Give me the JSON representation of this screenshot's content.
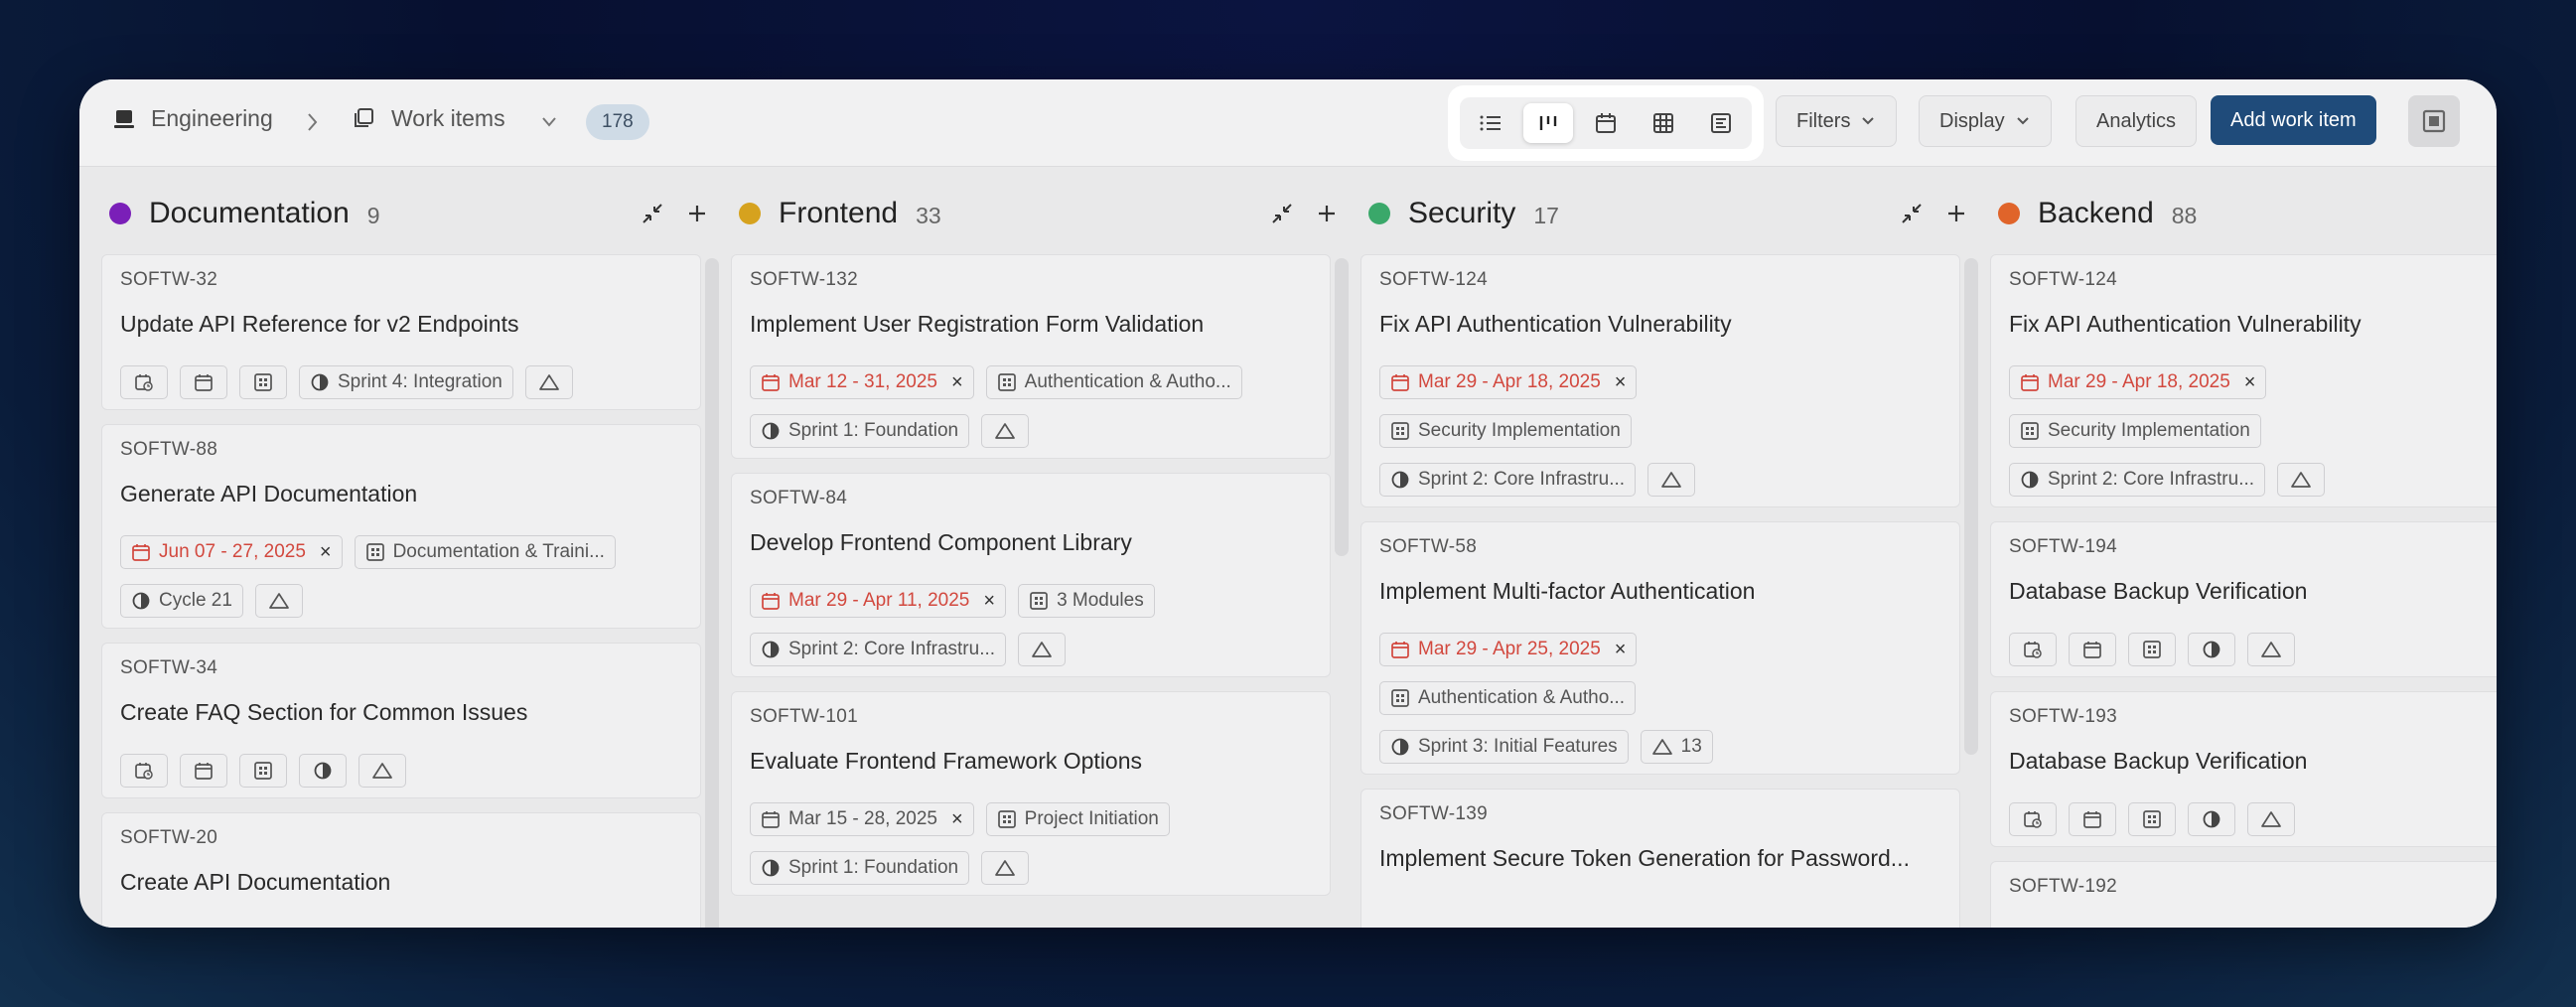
{
  "header": {
    "workspace": "Engineering",
    "section": "Work items",
    "count": "178",
    "filters_label": "Filters",
    "display_label": "Display",
    "analytics_label": "Analytics",
    "add_label": "Add work item"
  },
  "columns": [
    {
      "title": "Documentation",
      "count": "9",
      "color": "#7a1fb8",
      "cards": [
        {
          "id": "SOFTW-32",
          "title": "Update API Reference for v2 Endpoints",
          "rows": [
            [
              {
                "icon": "clock"
              },
              {
                "icon": "calendar"
              },
              {
                "icon": "module"
              },
              {
                "icon": "cycle",
                "text": "Sprint 4: Integration"
              },
              {
                "icon": "estimate"
              }
            ]
          ]
        },
        {
          "id": "SOFTW-88",
          "title": "Generate API Documentation",
          "rows": [
            [
              {
                "icon": "calendar",
                "text": "Jun 07 - 27, 2025",
                "red": true,
                "x": true
              },
              {
                "icon": "module",
                "text": "Documentation & Traini..."
              }
            ],
            [
              {
                "icon": "cycle",
                "text": "Cycle 21"
              },
              {
                "icon": "estimate"
              }
            ]
          ]
        },
        {
          "id": "SOFTW-34",
          "title": "Create FAQ Section for Common Issues",
          "rows": [
            [
              {
                "icon": "clock"
              },
              {
                "icon": "calendar"
              },
              {
                "icon": "module"
              },
              {
                "icon": "cycle"
              },
              {
                "icon": "estimate"
              }
            ]
          ]
        },
        {
          "id": "SOFTW-20",
          "title": "Create API Documentation",
          "rows": []
        }
      ]
    },
    {
      "title": "Frontend",
      "count": "33",
      "color": "#d6a21e",
      "cards": [
        {
          "id": "SOFTW-132",
          "title": "Implement User Registration Form Validation",
          "rows": [
            [
              {
                "icon": "calendar",
                "text": "Mar 12 - 31, 2025",
                "red": true,
                "x": true
              },
              {
                "icon": "module",
                "text": "Authentication & Autho..."
              }
            ],
            [
              {
                "icon": "cycle",
                "text": "Sprint 1: Foundation"
              },
              {
                "icon": "estimate"
              }
            ]
          ]
        },
        {
          "id": "SOFTW-84",
          "title": "Develop Frontend Component Library",
          "rows": [
            [
              {
                "icon": "calendar",
                "text": "Mar 29 - Apr 11, 2025",
                "red": true,
                "x": true
              },
              {
                "icon": "module",
                "text": "3 Modules"
              }
            ],
            [
              {
                "icon": "cycle",
                "text": "Sprint 2: Core Infrastru..."
              },
              {
                "icon": "estimate"
              }
            ]
          ]
        },
        {
          "id": "SOFTW-101",
          "title": "Evaluate Frontend Framework Options",
          "rows": [
            [
              {
                "icon": "calendar",
                "text": "Mar 15 - 28, 2025",
                "x": true
              },
              {
                "icon": "module",
                "text": "Project Initiation"
              }
            ],
            [
              {
                "icon": "cycle",
                "text": "Sprint 1: Foundation"
              },
              {
                "icon": "estimate"
              }
            ]
          ]
        }
      ]
    },
    {
      "title": "Security",
      "count": "17",
      "color": "#3aa86a",
      "cards": [
        {
          "id": "SOFTW-124",
          "title": "Fix API Authentication Vulnerability",
          "rows": [
            [
              {
                "icon": "calendar",
                "text": "Mar 29 - Apr 18, 2025",
                "red": true,
                "x": true
              }
            ],
            [
              {
                "icon": "module",
                "text": "Security Implementation"
              }
            ],
            [
              {
                "icon": "cycle",
                "text": "Sprint 2: Core Infrastru..."
              },
              {
                "icon": "estimate"
              }
            ]
          ]
        },
        {
          "id": "SOFTW-58",
          "title": "Implement Multi-factor Authentication",
          "rows": [
            [
              {
                "icon": "calendar",
                "text": "Mar 29 - Apr 25, 2025",
                "red": true,
                "x": true
              }
            ],
            [
              {
                "icon": "module",
                "text": "Authentication & Autho..."
              }
            ],
            [
              {
                "icon": "cycle",
                "text": "Sprint 3: Initial Features"
              },
              {
                "icon": "estimate",
                "text": "13"
              }
            ]
          ]
        },
        {
          "id": "SOFTW-139",
          "title": "Implement Secure Token Generation for Password...",
          "rows": []
        }
      ]
    },
    {
      "title": "Backend",
      "count": "88",
      "color": "#e0642a",
      "cards": [
        {
          "id": "SOFTW-124",
          "title": "Fix API Authentication Vulnerability",
          "rows": [
            [
              {
                "icon": "calendar",
                "text": "Mar 29 - Apr 18, 2025",
                "red": true,
                "x": true
              }
            ],
            [
              {
                "icon": "module",
                "text": "Security Implementation"
              }
            ],
            [
              {
                "icon": "cycle",
                "text": "Sprint 2: Core Infrastru..."
              },
              {
                "icon": "estimate"
              }
            ]
          ]
        },
        {
          "id": "SOFTW-194",
          "title": "Database Backup Verification",
          "rows": [
            [
              {
                "icon": "clock"
              },
              {
                "icon": "calendar"
              },
              {
                "icon": "module"
              },
              {
                "icon": "cycle"
              },
              {
                "icon": "estimate"
              }
            ]
          ]
        },
        {
          "id": "SOFTW-193",
          "title": "Database Backup Verification",
          "rows": [
            [
              {
                "icon": "clock"
              },
              {
                "icon": "calendar"
              },
              {
                "icon": "module"
              },
              {
                "icon": "cycle"
              },
              {
                "icon": "estimate"
              }
            ]
          ]
        },
        {
          "id": "SOFTW-192",
          "title": "",
          "rows": []
        }
      ]
    }
  ]
}
